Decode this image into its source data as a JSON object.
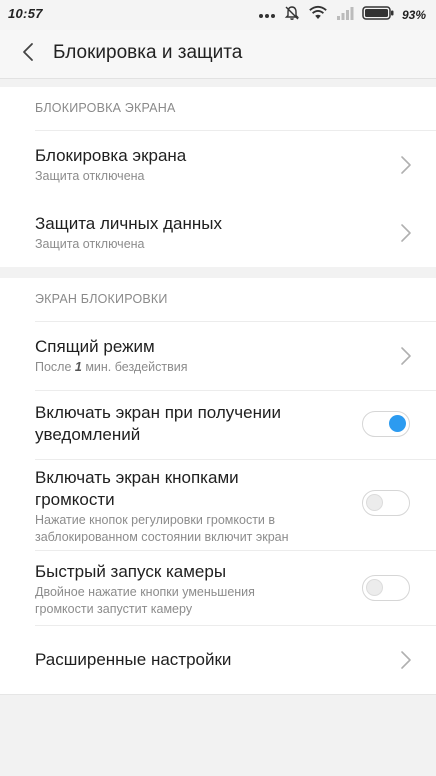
{
  "status_bar": {
    "time": "10:57",
    "icons": [
      "more-dots-icon",
      "alarm-off-icon",
      "wifi-icon",
      "signal-icon",
      "battery-icon"
    ],
    "battery_percent": "93%"
  },
  "header": {
    "title": "Блокировка и защита",
    "back_icon": "chevron-left-icon"
  },
  "sections": [
    {
      "title": "БЛОКИРОВКА ЭКРАНА",
      "items": [
        {
          "title": "Блокировка экрана",
          "subtitle": "Защита отключена",
          "control": "chevron"
        },
        {
          "title": "Защита личных данных",
          "subtitle": "Защита отключена",
          "control": "chevron"
        }
      ]
    },
    {
      "title": "ЭКРАН БЛОКИРОВКИ",
      "items": [
        {
          "title": "Спящий режим",
          "subtitle_prefix": "После ",
          "subtitle_bold": "1",
          "subtitle_suffix": " мин. бездействия",
          "control": "chevron"
        },
        {
          "title_line1": "Включать экран при получении",
          "title_line2": "уведомлений",
          "control": "toggle",
          "on": true
        },
        {
          "title_line1": "Включать экран кнопками",
          "title_line2": "громкости",
          "subtitle_line1": "Нажатие кнопок регулировки громкости в",
          "subtitle_line2": "заблокированном состоянии включит экран",
          "control": "toggle",
          "on": false
        },
        {
          "title": "Быстрый запуск камеры",
          "subtitle_line1": "Двойное нажатие кнопки уменьшения",
          "subtitle_line2": "громкости запустит камеру",
          "control": "toggle",
          "on": false
        },
        {
          "title": "Расширенные настройки",
          "control": "chevron"
        }
      ]
    }
  ],
  "colors": {
    "accent": "#2c9bf0",
    "background": "#f2f2f2",
    "card": "#ffffff",
    "secondary_text": "#8c8c8c"
  }
}
